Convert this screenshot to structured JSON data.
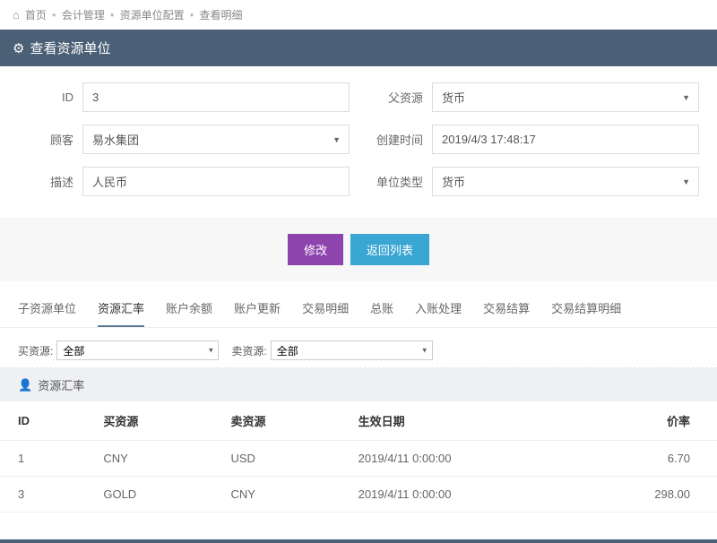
{
  "breadcrumb": {
    "home": "首页",
    "items": [
      "会计管理",
      "资源单位配置",
      "查看明细"
    ]
  },
  "header": {
    "title": "查看资源单位"
  },
  "form": {
    "id_label": "ID",
    "id_value": "3",
    "parent_label": "父资源",
    "parent_value": "货币",
    "customer_label": "顾客",
    "customer_value": "易水集团",
    "created_label": "创建时间",
    "created_value": "2019/4/3 17:48:17",
    "desc_label": "描述",
    "desc_value": "人民币",
    "unittype_label": "单位类型",
    "unittype_value": "货币"
  },
  "buttons": {
    "modify": "修改",
    "back": "返回列表"
  },
  "tabs": [
    "子资源单位",
    "资源汇率",
    "账户余额",
    "账户更新",
    "交易明细",
    "总账",
    "入账处理",
    "交易结算",
    "交易结算明细"
  ],
  "active_tab_index": 1,
  "filters": {
    "buy_label": "买资源:",
    "buy_value": "全部",
    "sell_label": "卖资源:",
    "sell_value": "全部"
  },
  "section_title": "资源汇率",
  "table": {
    "headers": {
      "id": "ID",
      "buy": "买资源",
      "sell": "卖资源",
      "date": "生效日期",
      "rate": "价率"
    },
    "rows": [
      {
        "id": "1",
        "buy": "CNY",
        "sell": "USD",
        "date": "2019/4/11 0:00:00",
        "rate": "6.70"
      },
      {
        "id": "3",
        "buy": "GOLD",
        "sell": "CNY",
        "date": "2019/4/11 0:00:00",
        "rate": "298.00"
      }
    ]
  }
}
